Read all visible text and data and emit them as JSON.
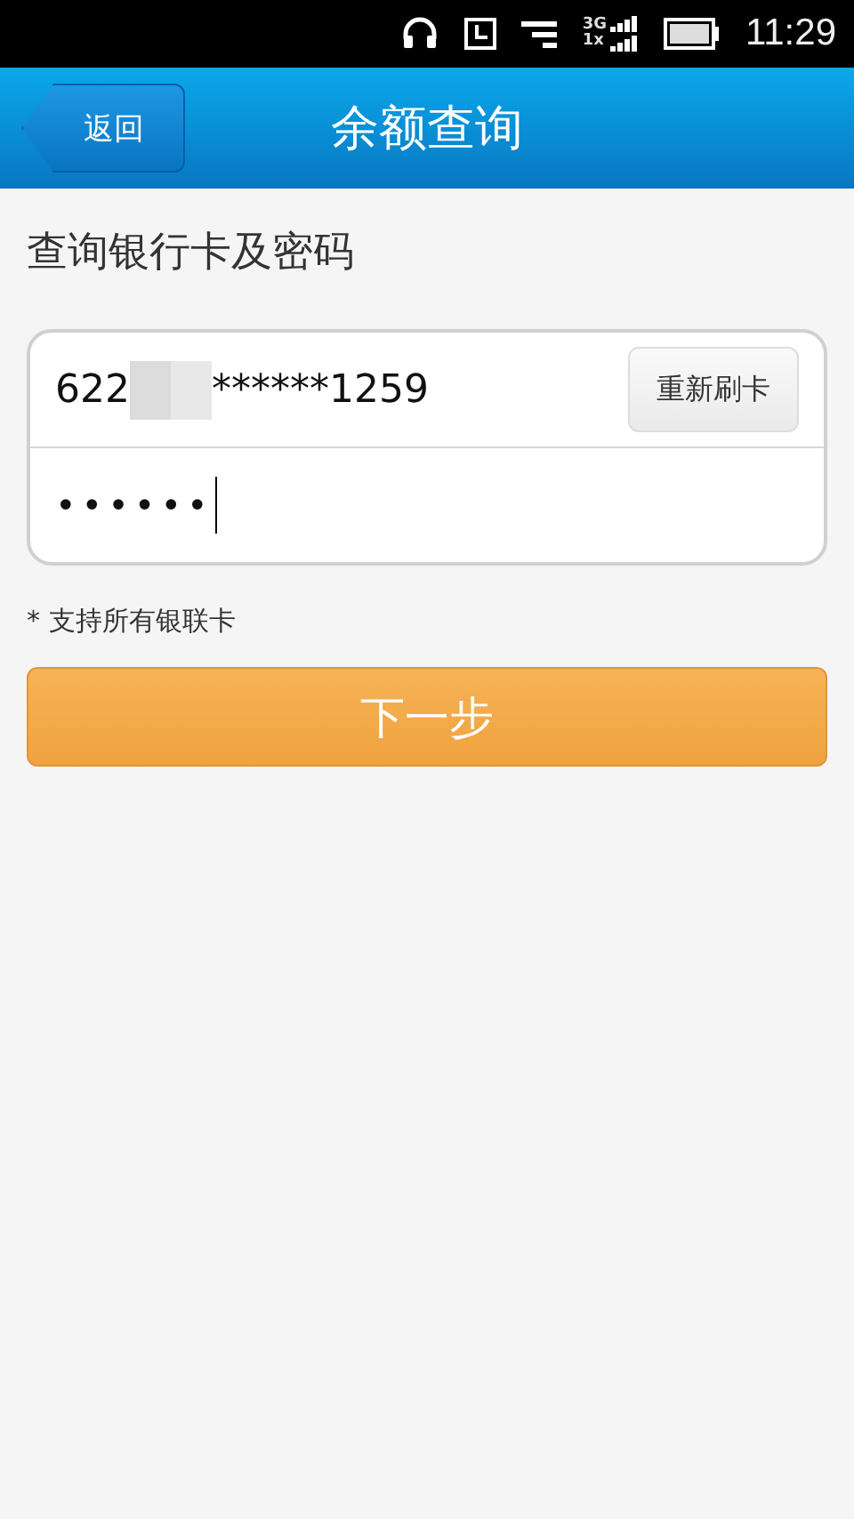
{
  "status_bar": {
    "network_top": "3G",
    "network_bottom": "1x",
    "time": "11:29"
  },
  "header": {
    "back": "返回",
    "title": "余额查询"
  },
  "section_title": "查询银行卡及密码",
  "form": {
    "card_prefix": "622",
    "card_suffix": "******1259",
    "reswipe": "重新刷卡",
    "password": "••••••"
  },
  "note": "* 支持所有银联卡",
  "next_button": "下一步"
}
